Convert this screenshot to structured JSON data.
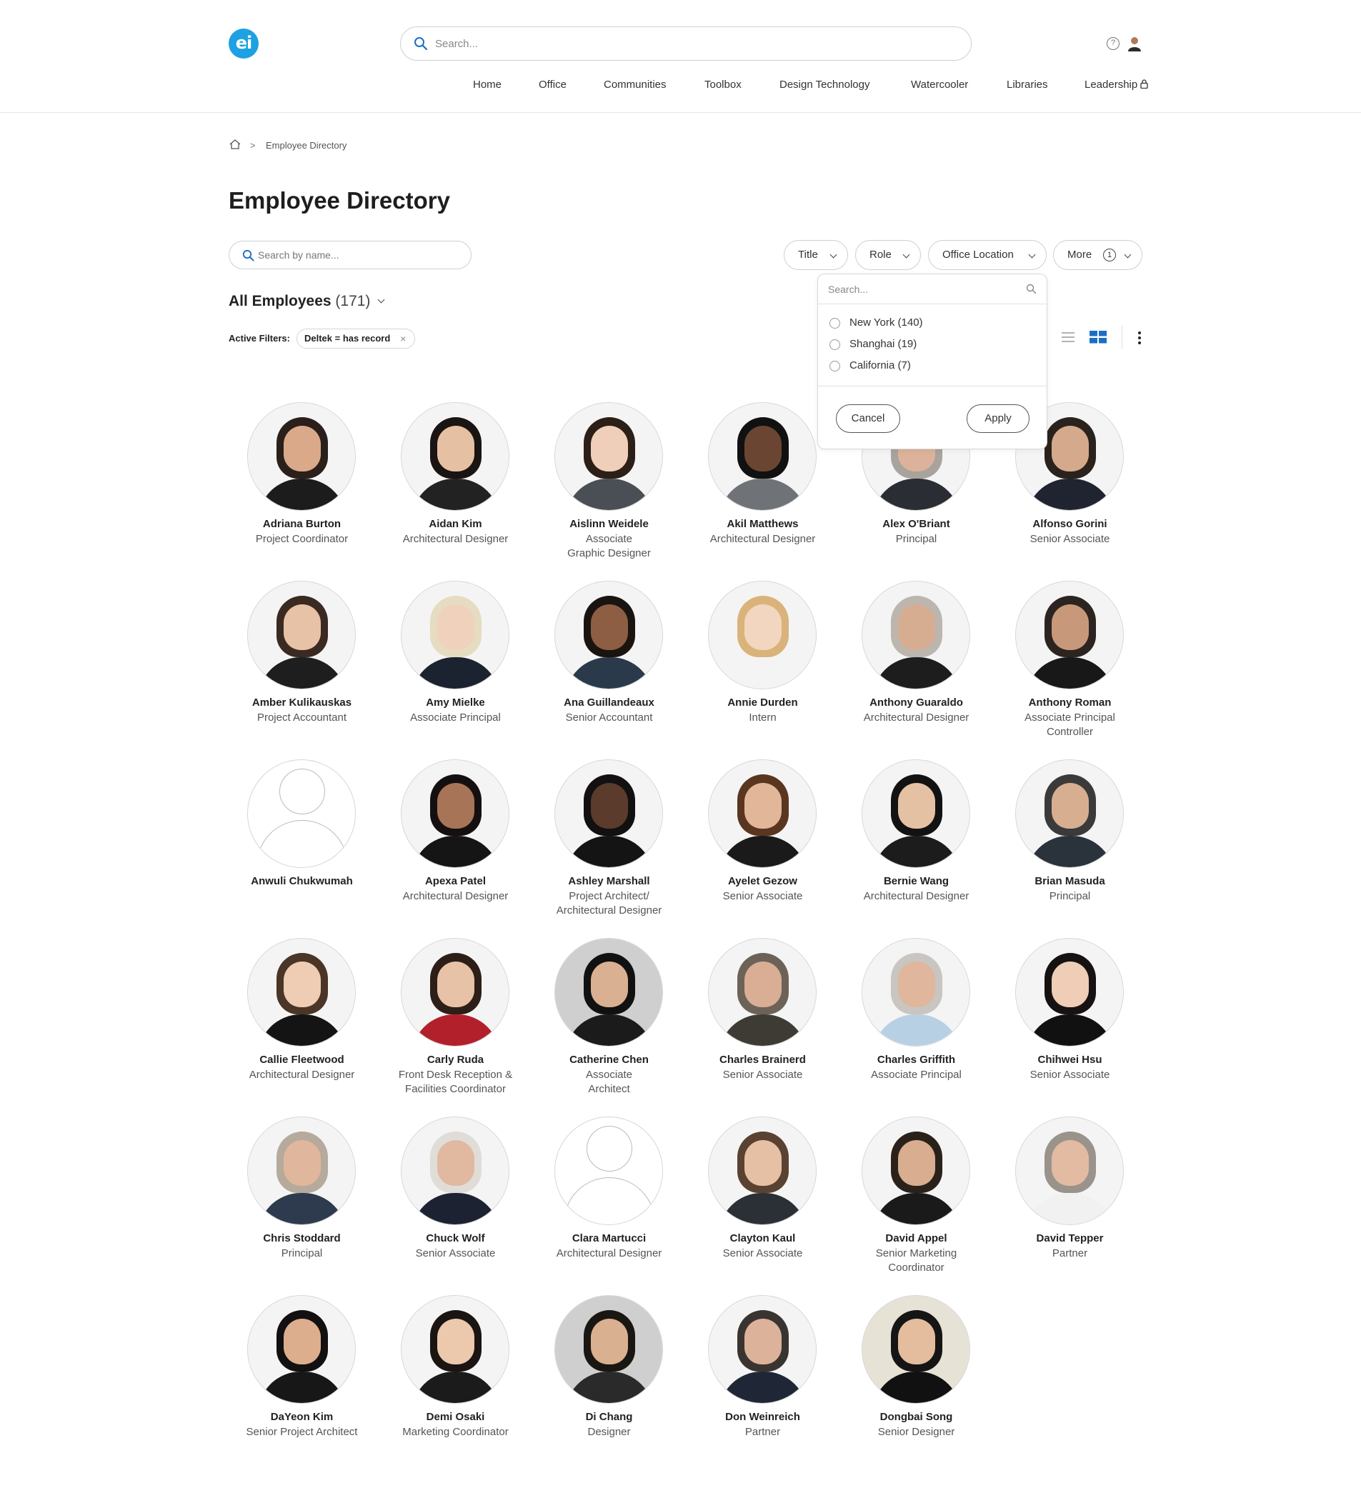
{
  "header": {
    "logo_text": "ei",
    "search_placeholder": "Search...",
    "nav": [
      "Home",
      "Office",
      "Communities",
      "Toolbox",
      "Design Technology",
      "Watercooler",
      "Libraries",
      "Leadership"
    ]
  },
  "breadcrumb": {
    "separator": ">",
    "current": "Employee Directory"
  },
  "page": {
    "title": "Employee Directory",
    "name_search_placeholder": "Search by name...",
    "filters": {
      "title": "Title",
      "role": "Role",
      "office_location": "Office Location",
      "more": "More",
      "more_count": "1"
    },
    "all_employees_label": "All Employees",
    "all_employees_count": "(171)",
    "active_filters_label": "Active Filters:",
    "active_filter_chip": "Deltek = has record",
    "chip_close": "×"
  },
  "dropdown": {
    "search_placeholder": "Search...",
    "options": [
      "New York (140)",
      "Shanghai (19)",
      "California (7)"
    ],
    "cancel": "Cancel",
    "apply": "Apply"
  },
  "employees": [
    {
      "name": "Adriana Burton",
      "title": "Project Coordinator",
      "photo": true,
      "hair": "#2a1f1a",
      "skin": "#d9a98a",
      "shirt": "#1c1c1c"
    },
    {
      "name": "Aidan Kim",
      "title": "Architectural Designer",
      "photo": true,
      "hair": "#1a1412",
      "skin": "#e6c0a2",
      "shirt": "#222222"
    },
    {
      "name": "Aislinn Weidele",
      "title": "Associate\nGraphic Designer",
      "photo": true,
      "hair": "#2b1f18",
      "skin": "#efcfb9",
      "shirt": "#4a4f55"
    },
    {
      "name": "Akil Matthews",
      "title": "Architectural Designer",
      "photo": true,
      "hair": "#111111",
      "skin": "#6a4632",
      "shirt": "#6f7377"
    },
    {
      "name": "Alex O'Briant",
      "title": "Principal",
      "photo": true,
      "hair": "#a8a39c",
      "skin": "#dcb39a",
      "shirt": "#2a2d33"
    },
    {
      "name": "Alfonso Gorini",
      "title": "Senior Associate",
      "photo": true,
      "hair": "#2a221d",
      "skin": "#d5a98c",
      "shirt": "#1f2430"
    },
    {
      "name": "Amber Kulikauskas",
      "title": "Project Accountant",
      "photo": true,
      "hair": "#3a2a22",
      "skin": "#e7c2a6",
      "shirt": "#1e1e1e"
    },
    {
      "name": "Amy Mielke",
      "title": "Associate Principal",
      "photo": true,
      "hair": "#e6dcc2",
      "skin": "#f0d1bc",
      "shirt": "#1b2230"
    },
    {
      "name": "Ana Guillandeaux",
      "title": "Senior Accountant",
      "photo": true,
      "hair": "#1a1410",
      "skin": "#8d5e43",
      "shirt": "#2b3a4a"
    },
    {
      "name": "Annie Durden",
      "title": "Intern",
      "photo": true,
      "hair": "#d9b37a",
      "skin": "#f3d6c0",
      "shirt": "#f4f4f4"
    },
    {
      "name": "Anthony Guaraldo",
      "title": "Architectural Designer",
      "photo": true,
      "hair": "#bcb6ae",
      "skin": "#d7ad92",
      "shirt": "#1d1d1d"
    },
    {
      "name": "Anthony Roman",
      "title": "Associate Principal\nController",
      "photo": true,
      "hair": "#2b2420",
      "skin": "#c8987a",
      "shirt": "#181818"
    },
    {
      "name": "Anwuli Chukwumah",
      "title": "",
      "photo": false
    },
    {
      "name": "Apexa Patel",
      "title": "Architectural Designer",
      "photo": true,
      "hair": "#151010",
      "skin": "#a87458",
      "shirt": "#151515"
    },
    {
      "name": "Ashley Marshall",
      "title": "Project Architect/\nArchitectural Designer",
      "photo": true,
      "hair": "#121010",
      "skin": "#5b3b2c",
      "shirt": "#141414"
    },
    {
      "name": "Ayelet Gezow",
      "title": "Senior Associate",
      "photo": true,
      "hair": "#5a3620",
      "skin": "#e2b699",
      "shirt": "#1a1a1a"
    },
    {
      "name": "Bernie Wang",
      "title": "Architectural Designer",
      "photo": true,
      "hair": "#121212",
      "skin": "#e5c1a3",
      "shirt": "#1c1c1c"
    },
    {
      "name": "Brian Masuda",
      "title": "Principal",
      "photo": true,
      "hair": "#3a3a3a",
      "skin": "#d7ae90",
      "shirt": "#2a323c"
    },
    {
      "name": "Callie Fleetwood",
      "title": "Architectural Designer",
      "photo": true,
      "hair": "#4a3526",
      "skin": "#efccb4",
      "shirt": "#141414"
    },
    {
      "name": "Carly Ruda",
      "title": "Front Desk Reception &\nFacilities Coordinator",
      "photo": true,
      "hair": "#2d1e18",
      "skin": "#e8c2a6",
      "shirt": "#b2202c"
    },
    {
      "name": "Catherine Chen",
      "title": "Associate\nArchitect",
      "photo": true,
      "hair": "#111111",
      "skin": "#d9b091",
      "shirt": "#1b1b1b",
      "bg": "#cfcfcf"
    },
    {
      "name": "Charles Brainerd",
      "title": "Senior Associate",
      "photo": true,
      "hair": "#6c6258",
      "skin": "#d9ae94",
      "shirt": "#3d3b33"
    },
    {
      "name": "Charles Griffith",
      "title": "Associate Principal",
      "photo": true,
      "hair": "#c9c5c0",
      "skin": "#e0b69c",
      "shirt": "#b8d0e4"
    },
    {
      "name": "Chihwei Hsu",
      "title": "Senior Associate",
      "photo": true,
      "hair": "#161212",
      "skin": "#efcdb6",
      "shirt": "#111111"
    },
    {
      "name": "Chris Stoddard",
      "title": "Principal",
      "photo": true,
      "hair": "#b5aa9c",
      "skin": "#e0b79c",
      "shirt": "#2e3a4e"
    },
    {
      "name": "Chuck Wolf",
      "title": "Senior Associate",
      "photo": true,
      "hair": "#e0ddd8",
      "skin": "#e1b9a0",
      "shirt": "#1d2233"
    },
    {
      "name": "Clara Martucci",
      "title": "Architectural Designer",
      "photo": false
    },
    {
      "name": "Clayton Kaul",
      "title": "Senior Associate",
      "photo": true,
      "hair": "#5a4232",
      "skin": "#e6c0a4",
      "shirt": "#2b2f36"
    },
    {
      "name": "David Appel",
      "title": "Senior Marketing\nCoordinator",
      "photo": true,
      "hair": "#2a211b",
      "skin": "#d9ad8f",
      "shirt": "#1a1a1a"
    },
    {
      "name": "David Tepper",
      "title": "Partner",
      "photo": true,
      "hair": "#9a938b",
      "skin": "#e2bba2",
      "shirt": "#f1f1f1"
    },
    {
      "name": "DaYeon Kim",
      "title": "Senior Project Architect",
      "photo": true,
      "hair": "#121010",
      "skin": "#dcae8e",
      "shirt": "#171717"
    },
    {
      "name": "Demi Osaki",
      "title": "Marketing Coordinator",
      "photo": true,
      "hair": "#1a1412",
      "skin": "#ecc8ad",
      "shirt": "#1b1b1b"
    },
    {
      "name": "Di Chang",
      "title": "Designer",
      "photo": true,
      "hair": "#1a1612",
      "skin": "#d9b090",
      "shirt": "#2a2a2a",
      "bg": "#cfcfcf"
    },
    {
      "name": "Don Weinreich",
      "title": "Partner",
      "photo": true,
      "hair": "#3a3430",
      "skin": "#dcb29a",
      "shirt": "#1f2737"
    },
    {
      "name": "Dongbai Song",
      "title": "Senior Designer",
      "photo": true,
      "hair": "#151515",
      "skin": "#e4bd9e",
      "shirt": "#111111",
      "bg": "#e7e2d6"
    }
  ]
}
